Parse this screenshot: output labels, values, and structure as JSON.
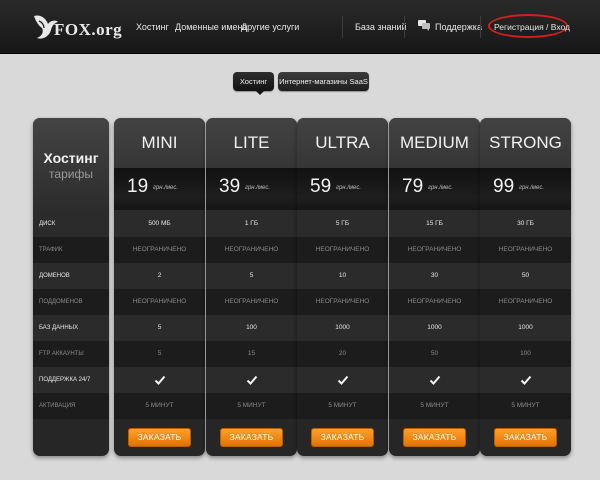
{
  "header": {
    "logo_text": "FOX.org",
    "nav": [
      {
        "label": "Хостинг"
      },
      {
        "label": "Доменные имена"
      },
      {
        "label": "Другие услуги"
      }
    ],
    "knowledge_base": "База знаний",
    "support": "Поддержка",
    "register_login": "Регистрация / Вход",
    "highlight_color": "#d21f1f"
  },
  "tabs": [
    {
      "label": "Хостинг",
      "active": true
    },
    {
      "label": "Интернет-магазины SaaS",
      "active": false
    }
  ],
  "pricing": {
    "title": "Хостинг",
    "subtitle": "тарифы",
    "features": [
      "ДИСК",
      "ТРАФИК",
      "ДОМЕНОВ",
      "ПОДДОМЕНОВ",
      "БАЗ ДАННЫХ",
      "FTP АККАУНТЫ",
      "ПОДДЕРЖКА 24/7",
      "АКТИВАЦИЯ"
    ],
    "price_unit": "грн./мес.",
    "order_label": "ЗАКАЗАТЬ",
    "accent_color": "#f08a0a",
    "plans": [
      {
        "name": "MINI",
        "price": "19",
        "values": [
          "500 МБ",
          "НЕОГРАНИЧЕНО",
          "2",
          "НЕОГРАНИЧЕНО",
          "5",
          "5",
          "check",
          "5 МИНУТ"
        ]
      },
      {
        "name": "LITE",
        "price": "39",
        "values": [
          "1 ГБ",
          "НЕОГРАНИЧЕНО",
          "5",
          "НЕОГРАНИЧЕНО",
          "100",
          "15",
          "check",
          "5 МИНУТ"
        ]
      },
      {
        "name": "ULTRA",
        "price": "59",
        "values": [
          "5 ГБ",
          "НЕОГРАНИЧЕНО",
          "10",
          "НЕОГРАНИЧЕНО",
          "1000",
          "20",
          "check",
          "5 МИНУТ"
        ]
      },
      {
        "name": "MEDIUM",
        "price": "79",
        "values": [
          "15 ГБ",
          "НЕОГРАНИЧЕНО",
          "30",
          "НЕОГРАНИЧЕНО",
          "1000",
          "50",
          "check",
          "5 МИНУТ"
        ]
      },
      {
        "name": "STRONG",
        "price": "99",
        "values": [
          "30 ГБ",
          "НЕОГРАНИЧЕНО",
          "50",
          "НЕОГРАНИЧЕНО",
          "1000",
          "100",
          "check",
          "5 МИНУТ"
        ]
      }
    ]
  }
}
